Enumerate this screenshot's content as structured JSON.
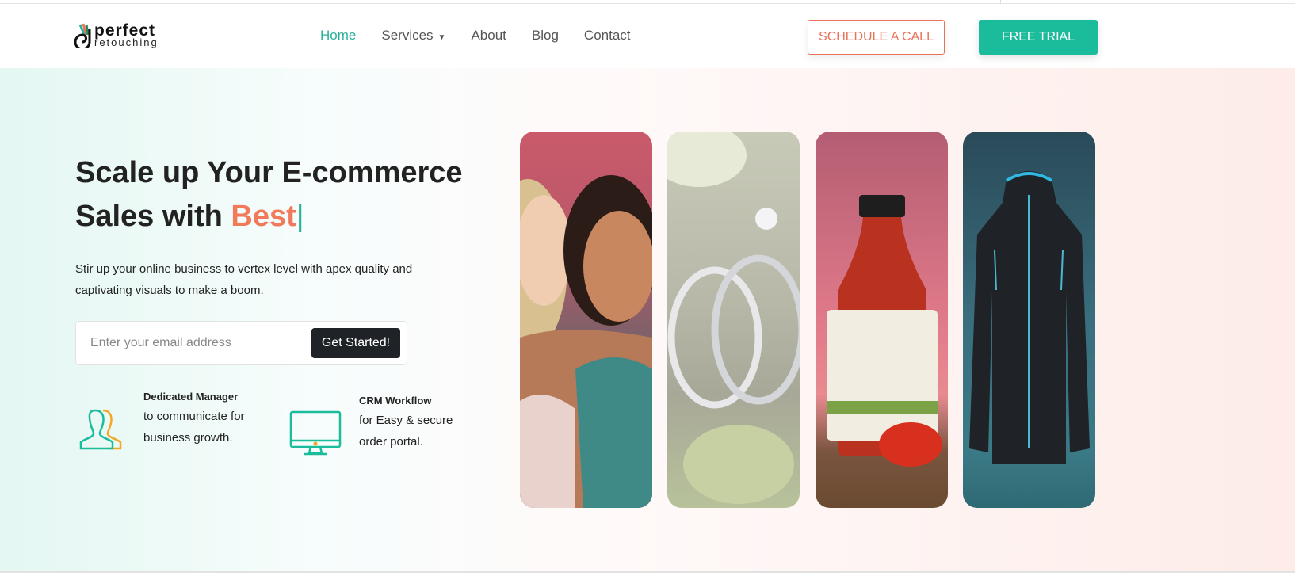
{
  "header": {
    "logo": {
      "line1": "perfect",
      "line2": "retouching"
    },
    "nav": [
      {
        "label": "Home",
        "active": true
      },
      {
        "label": "Services",
        "has_dropdown": true
      },
      {
        "label": "About"
      },
      {
        "label": "Blog"
      },
      {
        "label": "Contact"
      }
    ],
    "schedule_label": "SCHEDULE A CALL",
    "trial_label": "FREE TRIAL"
  },
  "hero": {
    "title_line1": "Scale up Your E-commerce",
    "title_line2_prefix": "Sales with ",
    "title_highlight": "Best",
    "cursor": "|",
    "subtitle": "Stir up your online business to vertex level with apex quality and captivating visuals to make a boom.",
    "email_placeholder": "Enter your email address",
    "cta_label": "Get Started!",
    "features": [
      {
        "icon": "users-icon",
        "title": "Dedicated Manager",
        "text": "to communicate for business growth."
      },
      {
        "icon": "monitor-icon",
        "title": "CRM Workflow",
        "text": "for Easy & secure order portal."
      }
    ],
    "cards": [
      "models-photo",
      "rings-photo",
      "sauce-bottle-photo",
      "jacket-photo"
    ]
  },
  "colors": {
    "accent": "#1bbc9b",
    "highlight": "#f07a5a",
    "dark": "#1f2328"
  }
}
